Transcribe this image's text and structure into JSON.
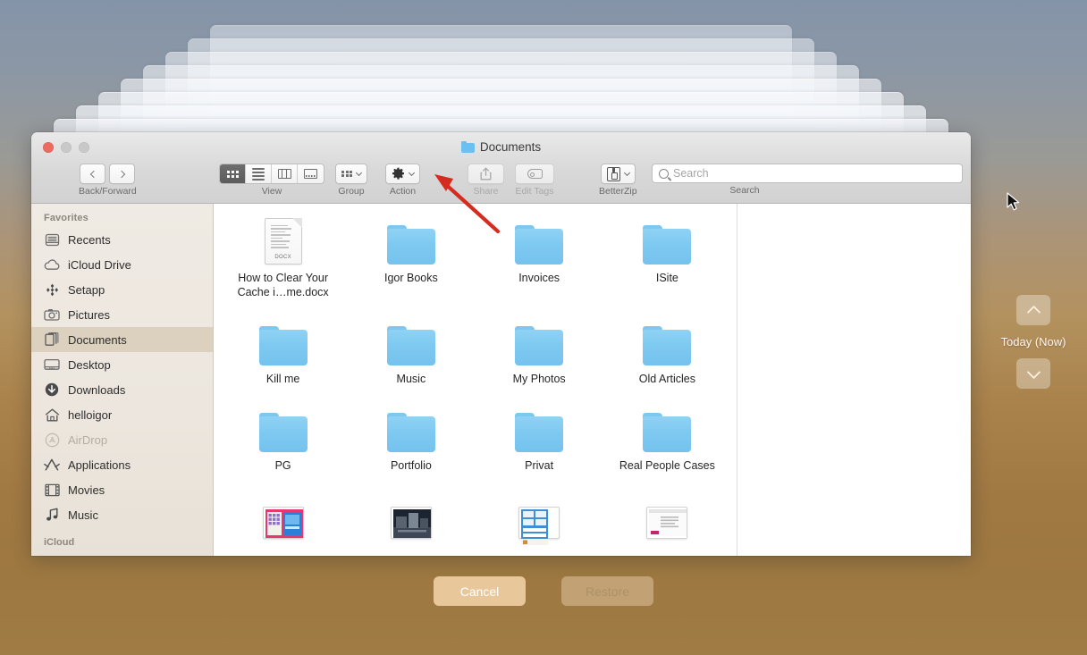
{
  "window": {
    "title": "Documents",
    "title_icon": "folder-icon",
    "traffic_lights": [
      {
        "name": "close",
        "color": "#ec6a5f",
        "enabled": true
      },
      {
        "name": "minimize",
        "color": "#c8c8c8",
        "enabled": false
      },
      {
        "name": "maximize",
        "color": "#c8c8c8",
        "enabled": false
      }
    ]
  },
  "toolbar": {
    "back_forward_label": "Back/Forward",
    "back_icon": "chevron-left-icon",
    "forward_icon": "chevron-right-icon",
    "view_label": "View",
    "view_modes": [
      {
        "name": "icon-view",
        "icon": "grid-icon",
        "selected": true
      },
      {
        "name": "list-view",
        "icon": "list-icon",
        "selected": false
      },
      {
        "name": "column-view",
        "icon": "columns-icon",
        "selected": false
      },
      {
        "name": "gallery-view",
        "icon": "gallery-icon",
        "selected": false
      }
    ],
    "group_label": "Group",
    "group_icon": "grid-arrange-icon",
    "action_label": "Action",
    "action_icon": "gear-icon",
    "share_label": "Share",
    "share_icon": "share-icon",
    "share_enabled": false,
    "edit_tags_label": "Edit Tags",
    "edit_tags_icon": "tag-icon",
    "edit_tags_enabled": false,
    "betterzip_label": "BetterZip",
    "betterzip_icon": "archive-icon",
    "search_label": "Search",
    "search_icon": "search-icon",
    "search_placeholder": "Search",
    "search_value": ""
  },
  "sidebar": {
    "favorites_header": "Favorites",
    "icloud_header": "iCloud",
    "items": [
      {
        "label": "Recents",
        "icon": "recents-icon",
        "selected": false,
        "enabled": true
      },
      {
        "label": "iCloud Drive",
        "icon": "cloud-icon",
        "selected": false,
        "enabled": true
      },
      {
        "label": "Setapp",
        "icon": "setapp-icon",
        "selected": false,
        "enabled": true
      },
      {
        "label": "Pictures",
        "icon": "camera-icon",
        "selected": false,
        "enabled": true
      },
      {
        "label": "Documents",
        "icon": "documents-icon",
        "selected": true,
        "enabled": true
      },
      {
        "label": "Desktop",
        "icon": "desktop-icon",
        "selected": false,
        "enabled": true
      },
      {
        "label": "Downloads",
        "icon": "download-icon",
        "selected": false,
        "enabled": true
      },
      {
        "label": "helloigor",
        "icon": "home-icon",
        "selected": false,
        "enabled": true
      },
      {
        "label": "AirDrop",
        "icon": "airdrop-icon",
        "selected": false,
        "enabled": false
      },
      {
        "label": "Applications",
        "icon": "applications-icon",
        "selected": false,
        "enabled": true
      },
      {
        "label": "Movies",
        "icon": "film-icon",
        "selected": false,
        "enabled": true
      },
      {
        "label": "Music",
        "icon": "music-note-icon",
        "selected": false,
        "enabled": true
      }
    ]
  },
  "files": [
    {
      "name": "How to Clear Your Cache i…me.docx",
      "kind": "docx",
      "badge": "DOCX"
    },
    {
      "name": "Igor Books",
      "kind": "folder"
    },
    {
      "name": "Invoices",
      "kind": "folder"
    },
    {
      "name": "ISite",
      "kind": "folder"
    },
    {
      "name": "Kill me",
      "kind": "folder"
    },
    {
      "name": "Music",
      "kind": "folder"
    },
    {
      "name": "My Photos",
      "kind": "folder"
    },
    {
      "name": "Old Articles",
      "kind": "folder"
    },
    {
      "name": "PG",
      "kind": "folder"
    },
    {
      "name": "Portfolio",
      "kind": "folder"
    },
    {
      "name": "Privat",
      "kind": "folder"
    },
    {
      "name": "Real People Cases",
      "kind": "folder"
    },
    {
      "name": "",
      "kind": "screenshot",
      "variant": "colorful-grid"
    },
    {
      "name": "",
      "kind": "screenshot",
      "variant": "dark-photo"
    },
    {
      "name": "",
      "kind": "screenshot",
      "variant": "blue-app"
    },
    {
      "name": "",
      "kind": "screenshot",
      "variant": "white-doc"
    }
  ],
  "timemachine": {
    "up_icon": "chevron-up-icon",
    "down_icon": "chevron-down-icon",
    "current_label": "Today (Now)"
  },
  "bottom": {
    "cancel_label": "Cancel",
    "cancel_enabled": true,
    "restore_label": "Restore",
    "restore_enabled": false
  },
  "annotation": {
    "arrow_color": "#d62b1f",
    "points_to": "action-menu-chevron"
  },
  "colors": {
    "folder_blue": "#7ec9f1",
    "sidebar_selection": "#dcd0bf",
    "cancel_button": "#e8c79a",
    "restore_button": "#c2a274",
    "close_light": "#ec6a5f"
  }
}
